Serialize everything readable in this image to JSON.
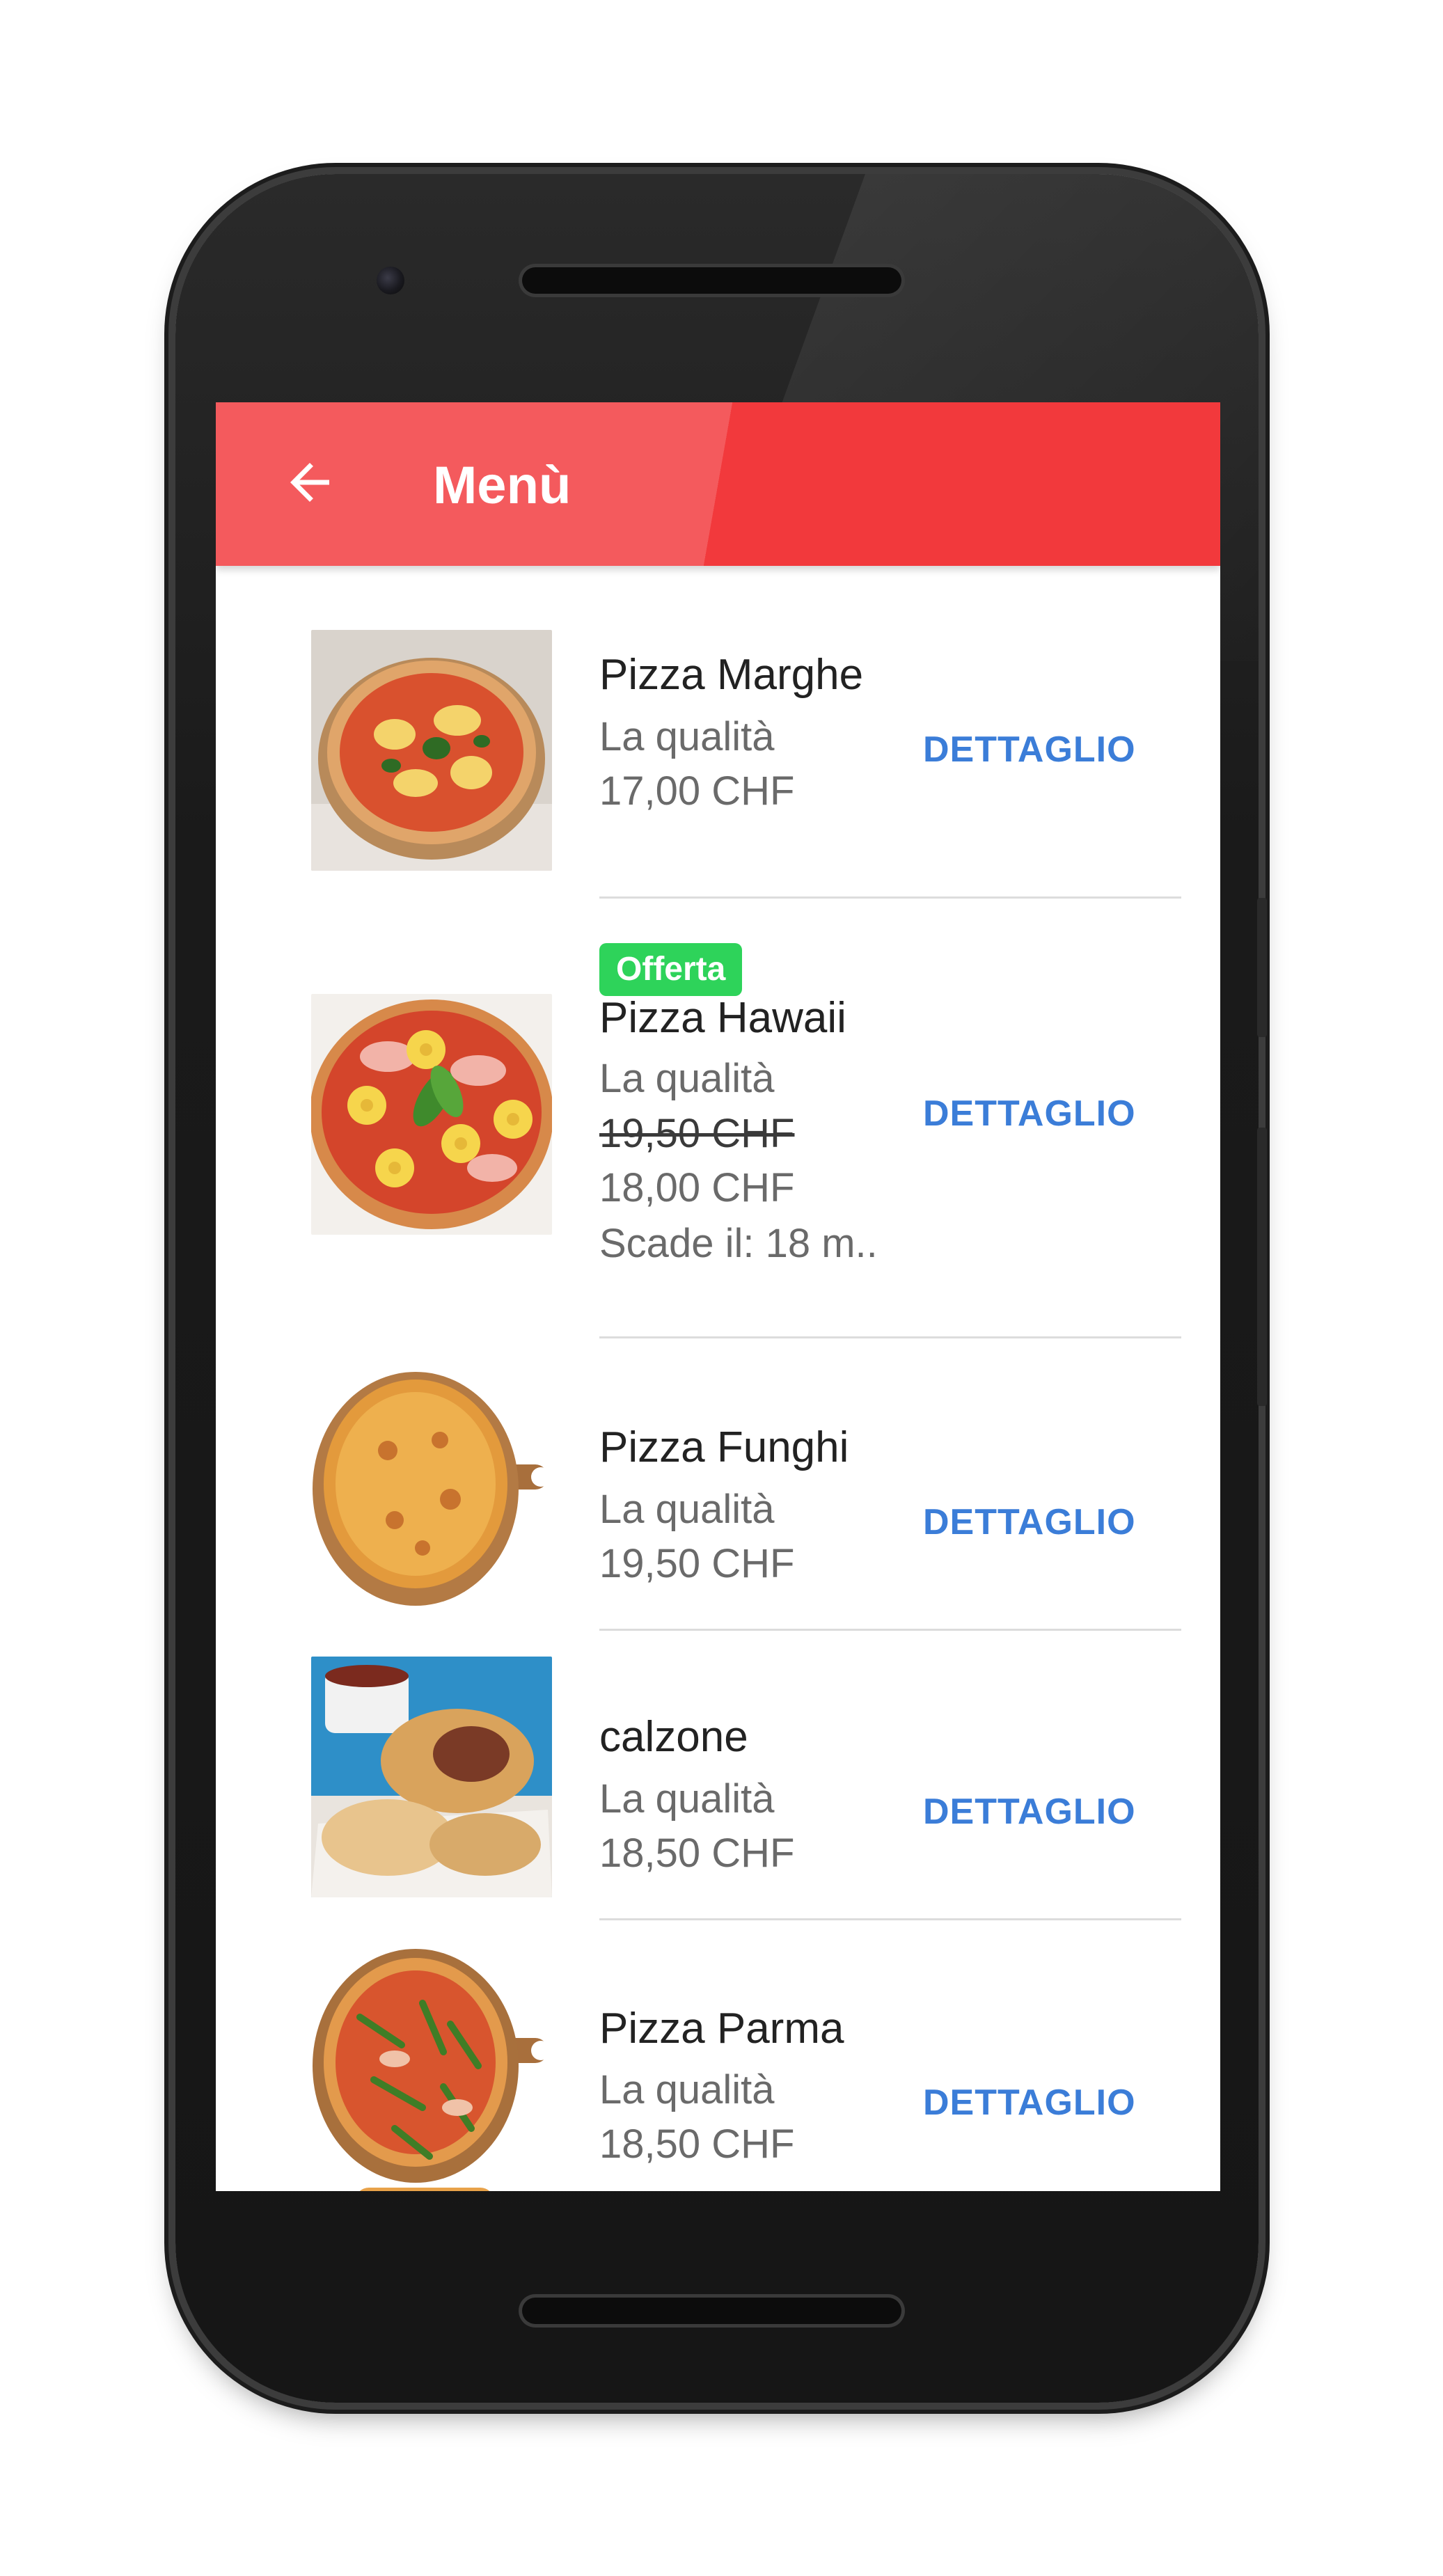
{
  "appbar": {
    "title": "Menù",
    "back_icon": "arrow-left-icon",
    "color_light": "#f45a5d",
    "color_dark": "#f2393c"
  },
  "menu_items": [
    {
      "name": "Pizza Marghe",
      "description": "La qualità",
      "price": "17,00 CHF",
      "detail_label": "DETTAGLIO"
    },
    {
      "badge": "Offerta",
      "name": "Pizza Hawaii",
      "description": "La qualità",
      "old_price": "19,50 CHF",
      "price": "18,00 CHF",
      "expiry": "Scade il: 18 m..",
      "detail_label": "DETTAGLIO"
    },
    {
      "name": "Pizza Funghi",
      "description": "La qualità",
      "price": "19,50 CHF",
      "detail_label": "DETTAGLIO"
    },
    {
      "name": "calzone",
      "description": "La qualità",
      "price": "18,50 CHF",
      "detail_label": "DETTAGLIO"
    },
    {
      "name": "Pizza Parma",
      "description": "La qualità",
      "price": "18,50 CHF",
      "detail_label": "DETTAGLIO"
    }
  ],
  "colors": {
    "accent_link": "#3b7dd8",
    "offer_badge": "#2ed35a"
  }
}
